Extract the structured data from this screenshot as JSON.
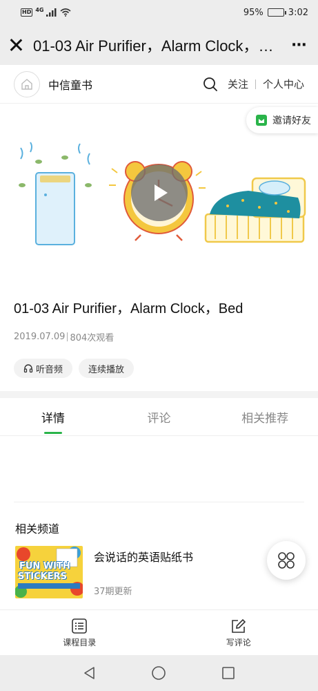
{
  "status_bar": {
    "network": "4G",
    "hd": "HD",
    "battery": "95%",
    "battery_level": 0.95,
    "time": "3:02"
  },
  "title_bar": {
    "title": "01-03 Air Purifier，Alarm Clock，Bed"
  },
  "channel_header": {
    "name": "中信童书",
    "follow": "关注",
    "personal_center": "个人中心"
  },
  "video": {
    "invite": "邀请好友"
  },
  "video_info": {
    "title": "01-03 Air Purifier，Alarm Clock，Bed",
    "date": "2019.07.09",
    "views": "804次观看",
    "listen_audio": "听音频",
    "continuous_play": "连续播放"
  },
  "tabs": [
    {
      "label": "详情",
      "active": true
    },
    {
      "label": "评论",
      "active": false
    },
    {
      "label": "相关推荐",
      "active": false
    }
  ],
  "related_channels": {
    "title": "相关频道",
    "items": [
      {
        "title": "会说话的英语贴纸书",
        "subtitle": "37期更新",
        "thumb_text": [
          "FUN WITH",
          "STICKERS"
        ]
      }
    ]
  },
  "bottom_toolbar": {
    "catalog": "课程目录",
    "write_comment": "写评论"
  },
  "colors": {
    "accent": "#2ab44a",
    "chrome": "#ededed",
    "text": "#111111",
    "muted": "#888888"
  }
}
